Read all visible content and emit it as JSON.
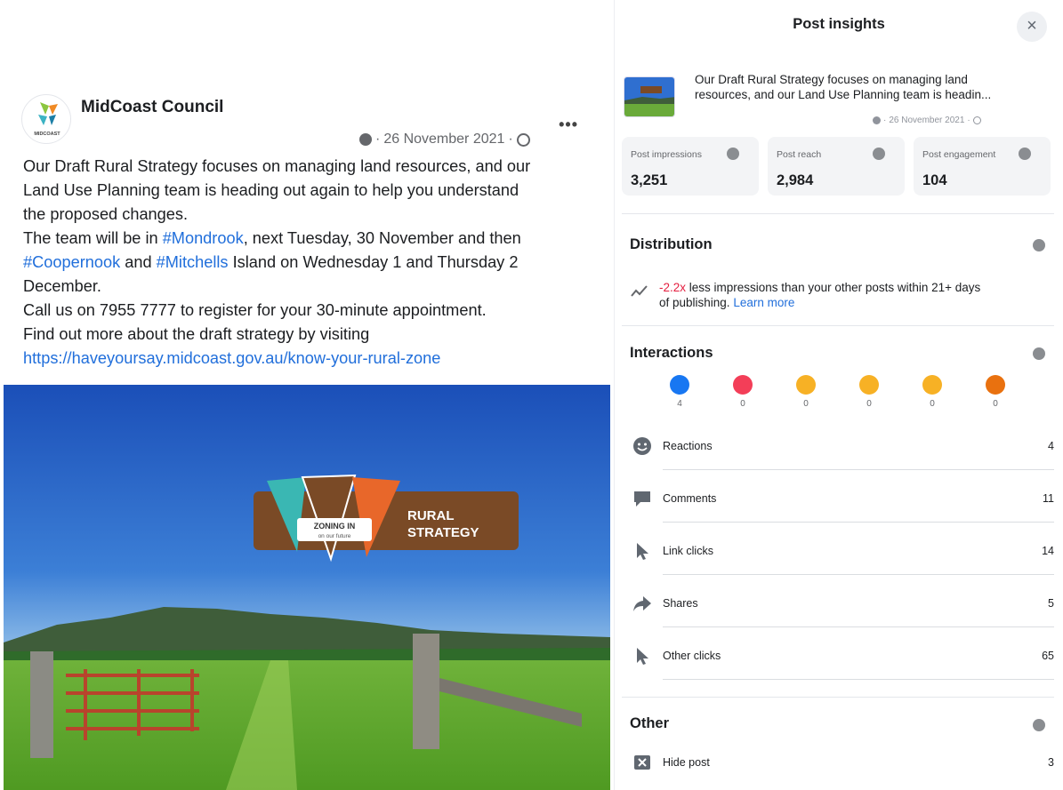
{
  "post": {
    "page_name": "MidCoast Council",
    "avatar_text": "MIDCOAST",
    "date": "26 November 2021",
    "more_label": "•••",
    "text": {
      "line1": "Our Draft Rural Strategy focuses on managing land resources, and our",
      "line2": "Land Use Planning team is heading out again to help you understand",
      "line3": "the proposed changes.",
      "line4_pre": "The team will be in ",
      "line4_tag": "#Mondrook",
      "line4_post": ", next Tuesday, 30 November and then",
      "line5_tag1": "#Coopernook",
      "line5_mid": " and ",
      "line5_tag2": "#Mitchells",
      "line5_post": " Island on Wednesday 1 and Thursday 2",
      "line6": "December.",
      "line7": "Call us on 7955 7777 to register for your 30-minute appointment.",
      "line8": "Find out more about the draft strategy by visiting",
      "link": "https://haveyoursay.midcoast.gov.au/know-your-rural-zone"
    },
    "image": {
      "badge_line1": "ZONING IN",
      "badge_line2": "on our future",
      "title_line1": "RURAL",
      "title_line2": "STRATEGY"
    }
  },
  "insights": {
    "title": "Post insights",
    "close_label": "×",
    "summary_line1": "Our Draft Rural Strategy focuses on managing land",
    "summary_line2": "resources, and our Land Use Planning team is headin...",
    "summary_date": "26 November 2021",
    "metrics": [
      {
        "label": "Post impressions",
        "value": "3,251"
      },
      {
        "label": "Post reach",
        "value": "2,984"
      },
      {
        "label": "Post engagement",
        "value": "104"
      }
    ],
    "distribution": {
      "title": "Distribution",
      "multiplier": "-2.2x",
      "text_a": " less impressions than your other posts within 21+ days",
      "text_b": "of publishing. ",
      "learn_more": "Learn more"
    },
    "interactions": {
      "title": "Interactions",
      "reactions": [
        {
          "name": "like",
          "count": "4",
          "color": "#1877f2"
        },
        {
          "name": "love",
          "count": "0",
          "color": "#f33e58"
        },
        {
          "name": "haha",
          "count": "0",
          "color": "#f7b125"
        },
        {
          "name": "wow",
          "count": "0",
          "color": "#f7b125"
        },
        {
          "name": "sad",
          "count": "0",
          "color": "#f7b125"
        },
        {
          "name": "angry",
          "count": "0",
          "color": "#e9710f"
        }
      ],
      "rows": [
        {
          "label": "Reactions",
          "value": "4",
          "icon": "smiley-icon"
        },
        {
          "label": "Comments",
          "value": "11",
          "icon": "comment-icon"
        },
        {
          "label": "Link clicks",
          "value": "14",
          "icon": "cursor-icon"
        },
        {
          "label": "Shares",
          "value": "5",
          "icon": "share-icon"
        },
        {
          "label": "Other clicks",
          "value": "65",
          "icon": "cursor-icon"
        }
      ]
    },
    "other": {
      "title": "Other",
      "rows": [
        {
          "label": "Hide post",
          "value": "3",
          "icon": "hide-icon"
        }
      ]
    }
  }
}
